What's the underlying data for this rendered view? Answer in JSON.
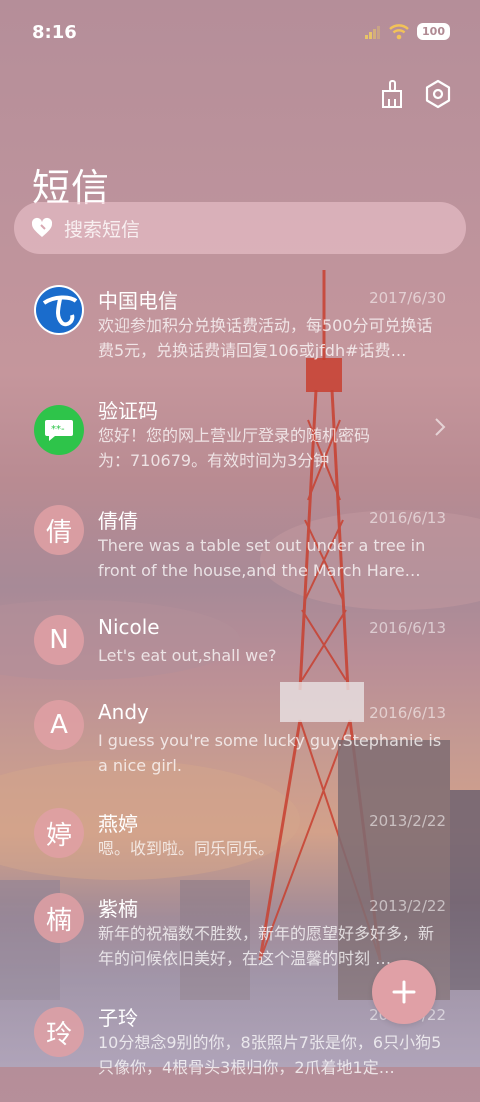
{
  "status": {
    "time": "8:16",
    "battery": "100"
  },
  "header": {
    "title": "短信"
  },
  "search": {
    "placeholder": "搜索短信"
  },
  "messages": [
    {
      "name": "中国电信",
      "date": "2017/6/30",
      "preview": "欢迎参加积分兑换话费活动，每500分可兑换话费5元，兑换话费请回复106或jfdh#话费…",
      "avatar": ""
    },
    {
      "name": "验证码",
      "date": "",
      "preview": "您好！您的网上营业厅登录的随机密码为：710679。有效时间为3分钟",
      "avatar": ""
    },
    {
      "name": "倩倩",
      "date": "2016/6/13",
      "preview": "There was a table set out under a tree in front of the house,and the March Hare an…",
      "avatar": "倩"
    },
    {
      "name": "Nicole",
      "date": "2016/6/13",
      "preview": "Let's eat out,shall we?",
      "avatar": "N"
    },
    {
      "name": "Andy",
      "date": "2016/6/13",
      "preview": "I guess you're some lucky guy.Stephanie is a nice girl.",
      "avatar": "A"
    },
    {
      "name": "燕婷",
      "date": "2013/2/22",
      "preview": "嗯。收到啦。同乐同乐。",
      "avatar": "婷"
    },
    {
      "name": "紫楠",
      "date": "2013/2/22",
      "preview": "新年的祝福数不胜数，新年的愿望好多好多，新年的问候依旧美好，在这个温馨的时刻 …",
      "avatar": "楠"
    },
    {
      "name": "子玲",
      "date": "2013/2/22",
      "preview": "10分想念9别的你，8张照片7张是你，6只小狗5只像你，4根骨头3根归你，2爪着地1定…",
      "avatar": "玲"
    }
  ],
  "colors": {
    "accent": "#e0a0a6",
    "telecom_blue": "#1a6ccc",
    "verify_green": "#2ec44a"
  },
  "icons": {
    "clean": "broom-icon",
    "settings": "hexagon-settings-icon",
    "search": "heart-search-icon",
    "compose": "plus-icon"
  }
}
